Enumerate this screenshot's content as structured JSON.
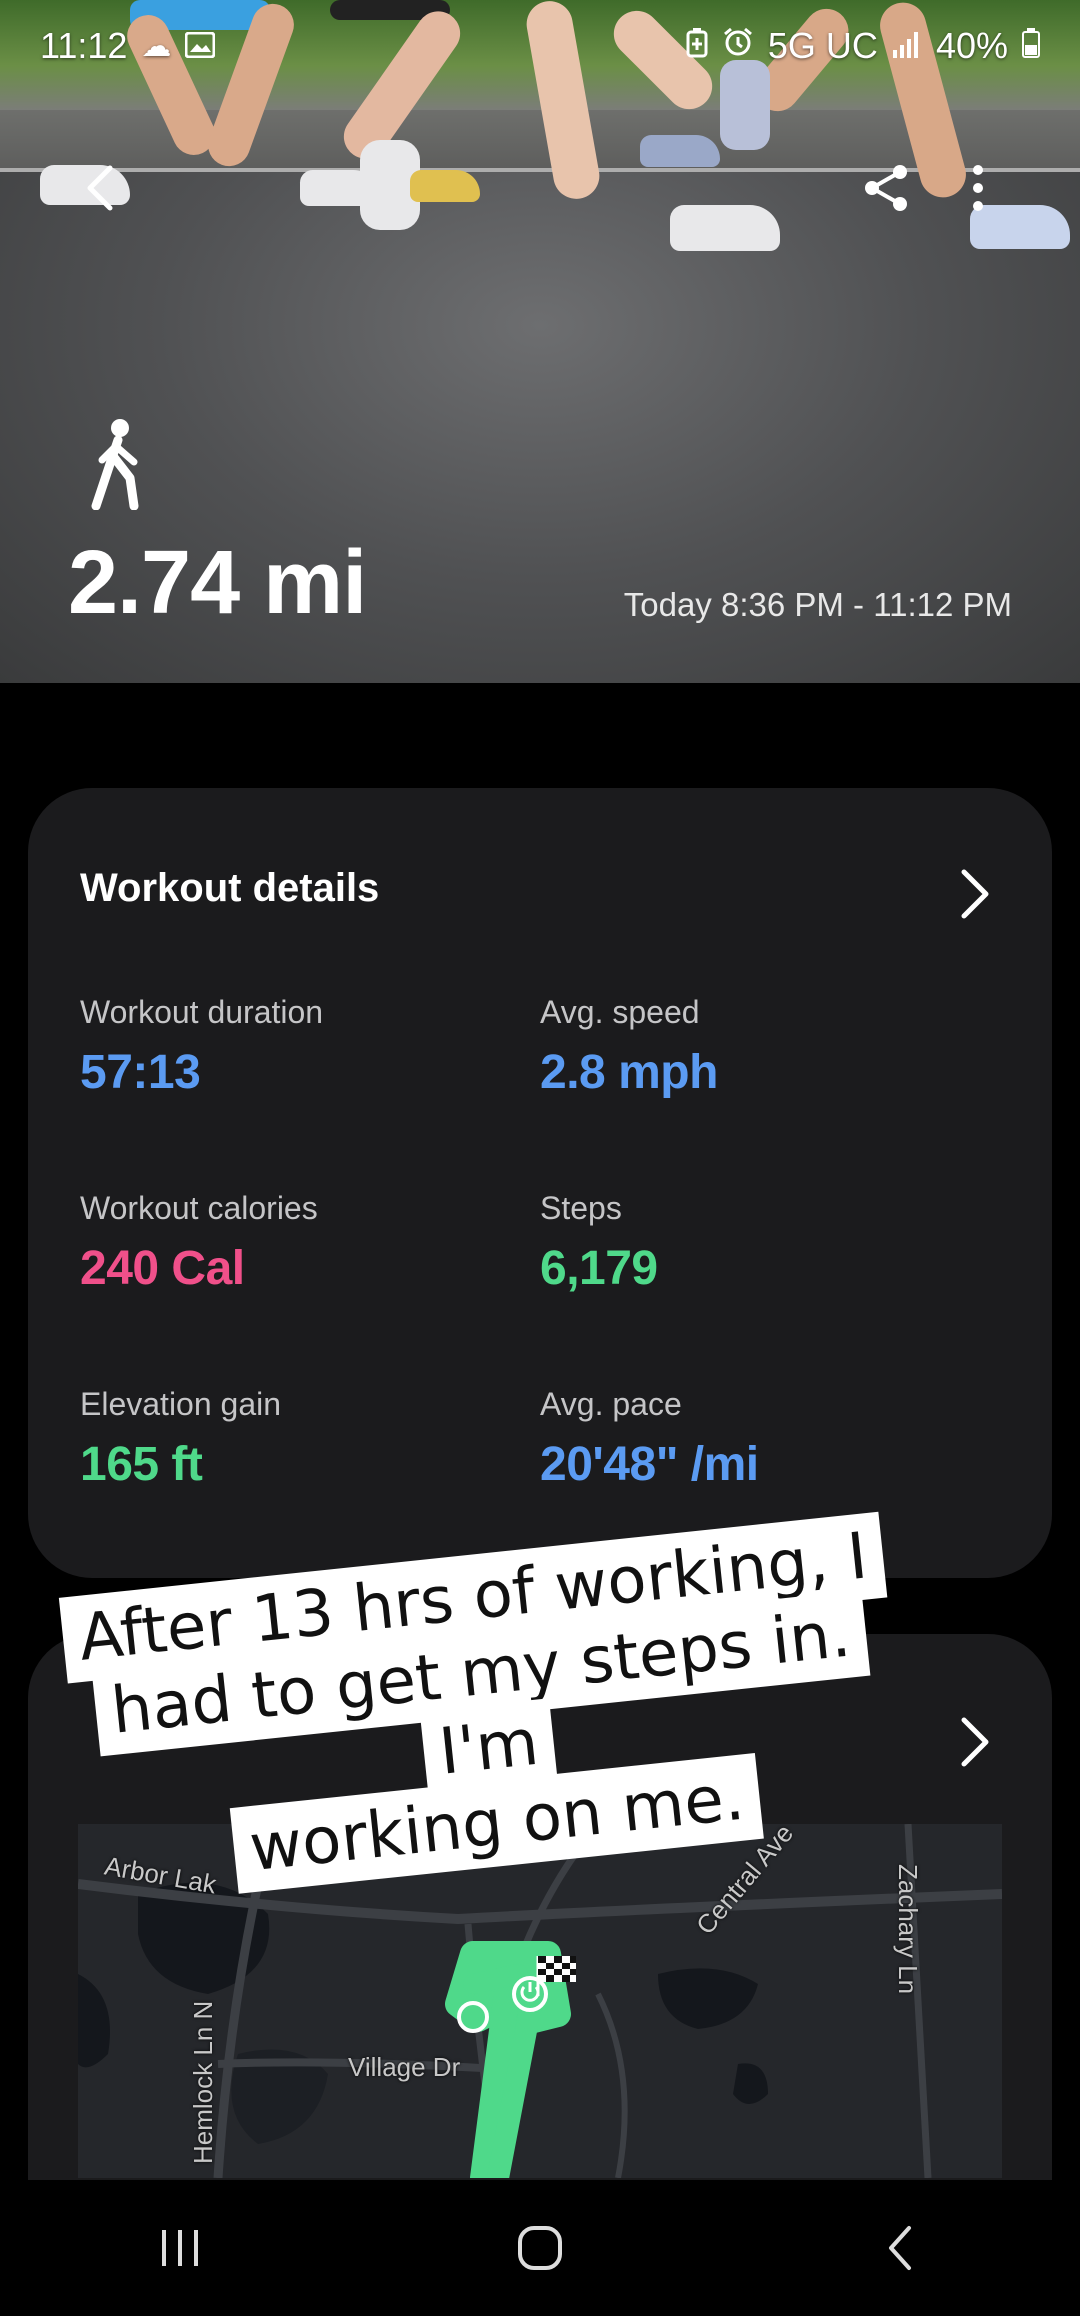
{
  "status_bar": {
    "time": "11:12",
    "network": "5G UC",
    "battery": "40%",
    "left_icons": [
      "cloud-icon",
      "image-icon"
    ],
    "right_icons": [
      "battery-saver-icon",
      "alarm-icon",
      "signal-icon",
      "battery-icon"
    ]
  },
  "hero": {
    "activity_icon": "walking-icon",
    "distance": "2.74 mi",
    "time_range": "Today 8:36 PM - 11:12 PM",
    "actions": [
      "back-icon",
      "share-icon",
      "more-options-icon"
    ]
  },
  "workout_details": {
    "title": "Workout details",
    "stats": [
      {
        "label": "Workout duration",
        "value": "57:13",
        "color": "#5b9bf2"
      },
      {
        "label": "Avg. speed",
        "value": "2.8 mph",
        "color": "#5b9bf2"
      },
      {
        "label": "Workout calories",
        "value": "240 Cal",
        "color": "#f0508a"
      },
      {
        "label": "Steps",
        "value": "6,179",
        "color": "#4fd98a"
      },
      {
        "label": "Elevation gain",
        "value": "165 ft",
        "color": "#4fd98a"
      },
      {
        "label": "Avg. pace",
        "value": "20'48\" /mi",
        "color": "#5b9bf2"
      }
    ]
  },
  "map_card": {
    "streets": [
      "Arbor Lak",
      "Central Ave",
      "Zachary Ln",
      "Hemlock Ln N",
      "Village Dr"
    ],
    "route_color": "#4fd98a"
  },
  "caption": {
    "lines": [
      "After 13 hrs of working, I",
      "had to get my steps in. I'm",
      "working on me."
    ]
  },
  "nav_bar": {
    "buttons": [
      "recent-apps-icon",
      "home-icon",
      "back-icon"
    ]
  }
}
